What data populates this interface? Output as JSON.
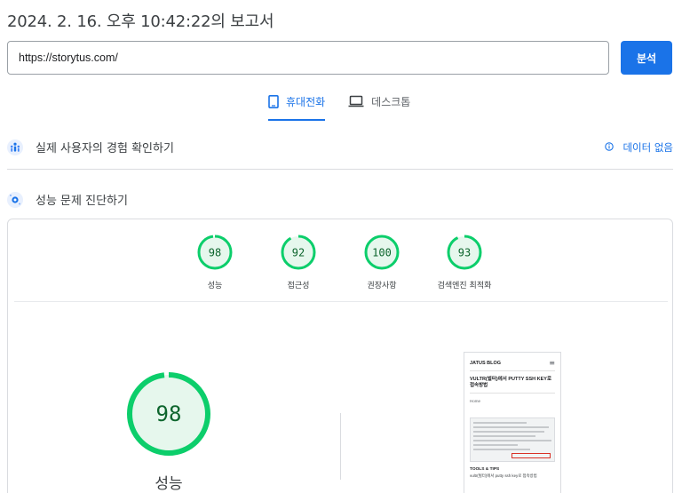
{
  "report": {
    "title": "2024. 2. 16. 오후 10:42:22의 보고서"
  },
  "search": {
    "url": "https://storytus.com/",
    "analyze_label": "분석"
  },
  "tabs": [
    {
      "label": "휴대전화",
      "icon": "smartphone-icon",
      "active": true
    },
    {
      "label": "데스크톱",
      "icon": "laptop-icon",
      "active": false
    }
  ],
  "field_data": {
    "heading": "실제 사용자의 경험 확인하기",
    "status": "데이터 없음",
    "icon": "people-icon",
    "status_icon": "info-icon"
  },
  "diagnose": {
    "heading": "성능 문제 진단하기",
    "icon": "lab-icon"
  },
  "scores": [
    {
      "value": 98,
      "label": "성능"
    },
    {
      "value": 92,
      "label": "접근성"
    },
    {
      "value": 100,
      "label": "권장사항"
    },
    {
      "value": 93,
      "label": "검색엔진 최적화"
    }
  ],
  "main_score": {
    "value": 98,
    "label": "성능"
  },
  "colors": {
    "accent": "#1a73e8",
    "pass": "#0cce6b",
    "pass_bg": "#e6f7ed",
    "pass_text": "#0d652d"
  },
  "screenshot": {
    "blog_name": "JATUS BLOG",
    "post_title": "VULTR(벌터)에서 PUTTY SSH KEY로 접속방법",
    "home_label": "Home",
    "tools_heading": "TOOLS & TIPS",
    "body_text": "vultr(벌터)에서 putty ssh key로 접속방법"
  }
}
